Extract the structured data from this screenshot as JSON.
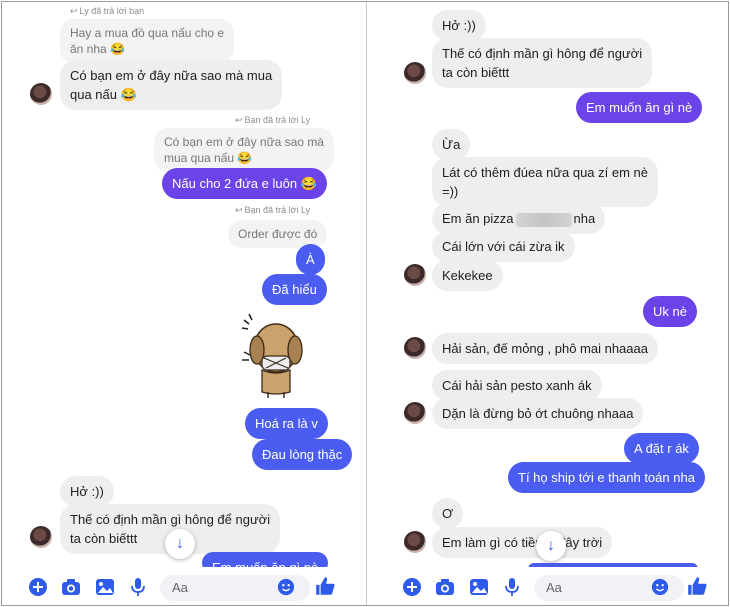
{
  "colors": {
    "sent_purple": "#6c43e8",
    "sent_blue": "#4a5df0",
    "received_bg": "#eeeeef",
    "accent": "#2f5bea"
  },
  "left": {
    "reply_header_1": "Ly đã trả lời bạn",
    "quoted_1_line1": "Hay a mua đồ qua nấu cho e",
    "quoted_1_line2": "ăn nha 😂",
    "msg_1_line1": "Có bạn em ở đây nữa sao mà mua",
    "msg_1_line2": "qua nấu 😂",
    "reply_header_2": "Bạn đã trả lời Ly",
    "quoted_2_line1": "Có bạn em ở đây nữa sao mà",
    "quoted_2_line2": "mua qua nấu 😂",
    "msg_2": "Nấu cho 2 đứa e luôn 😂",
    "reply_header_3": "Bạn đã trả lời Ly",
    "quoted_3": "Order được đó",
    "msg_3": "À",
    "msg_4": "Đã hiểu",
    "sticker_icon": "crying-dog-sticker",
    "msg_5": "Hoá ra là v",
    "msg_6": "Đau lòng thặc",
    "msg_7": "Hở :))",
    "msg_8_line1": "Thế có định mần gì hông để người",
    "msg_8_line2": "ta còn biếttt",
    "msg_9_partial": "Em muốn ăn gì nè",
    "input_placeholder": "Aa"
  },
  "right": {
    "msg_1": "Hở :))",
    "msg_2_line1": "Thế có định mần gì hông để người",
    "msg_2_line2": "ta còn biếttt",
    "msg_3": "Em muốn ăn gì nè",
    "msg_4": "Ừa",
    "msg_5_line1": "Lát có thêm đúea nữa qua zí em nè",
    "msg_5_line2": "=))",
    "msg_6_a": "Em ăn pizza",
    "msg_6_b": "nha",
    "msg_7": "Cái lớn với cái zừa ik",
    "msg_8": "Kekekee",
    "msg_9": "Uk nè",
    "msg_10": "Hải sản, đế mỏng , phô mai nhaaaa",
    "msg_11": "Cái hải sản pesto xanh ák",
    "msg_12": "Dặn là đừng bỏ ớt chuông nhaaa",
    "msg_13": "A đặt r ák",
    "msg_14": "Tí họ ship tới e thanh toán nha",
    "msg_15": "Ơ",
    "msg_16": "Em làm gì có tiền ở đây trời",
    "input_placeholder": "Aa"
  },
  "icons": [
    "plus-icon",
    "camera-icon",
    "gallery-icon",
    "microphone-icon",
    "emoji-icon",
    "like-icon",
    "scroll-down-icon",
    "reply-arrow-icon"
  ]
}
